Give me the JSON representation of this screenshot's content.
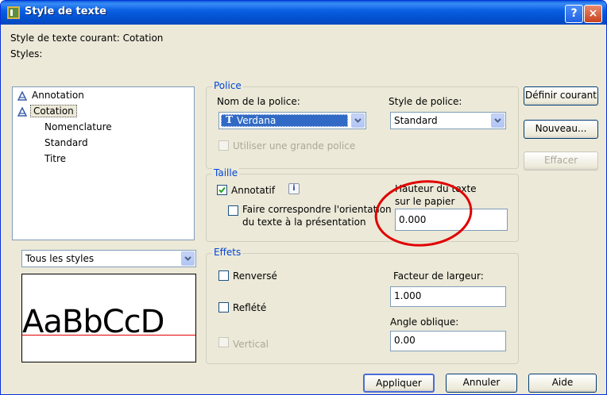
{
  "window": {
    "title": "Style de texte",
    "help_button": "?",
    "close_button": "×"
  },
  "current_style": "Style de texte courant: Cotation",
  "styles": {
    "label": "Styles:",
    "items": [
      {
        "label": "Annotation",
        "annotative": true,
        "selected": false
      },
      {
        "label": "Cotation",
        "annotative": true,
        "selected": true
      },
      {
        "label": "Nomenclature",
        "annotative": false,
        "selected": false
      },
      {
        "label": "Standard",
        "annotative": false,
        "selected": false
      },
      {
        "label": "Titre",
        "annotative": false,
        "selected": false
      }
    ],
    "filter_value": "Tous les styles",
    "preview_text": "AaBbCcD"
  },
  "police": {
    "legend": "Police",
    "font_name_label": "Nom de la police:",
    "font_name_value": "Verdana",
    "font_style_label": "Style de police:",
    "font_style_value": "Standard",
    "bigfont_label": "Utiliser une grande police"
  },
  "taille": {
    "legend": "Taille",
    "annotative_label": "Annotatif",
    "annotative_checked": true,
    "info_icon": "i",
    "match_orientation_line1": "Faire correspondre l'orientation",
    "match_orientation_line2": "du texte à la présentation",
    "paper_height_line1": "Hauteur du texte",
    "paper_height_line2": "sur le papier",
    "paper_height_value": "0.000"
  },
  "effets": {
    "legend": "Effets",
    "upside_down_label": "Renversé",
    "backwards_label": "Reflété",
    "vertical_label": "Vertical",
    "width_factor_label": "Facteur de largeur:",
    "width_factor_value": "1.000",
    "oblique_angle_label": "Angle oblique:",
    "oblique_angle_value": "0.00"
  },
  "buttons": {
    "set_current": "Définir courant",
    "new": "Nouveau...",
    "delete": "Effacer",
    "apply": "Appliquer",
    "cancel": "Annuler",
    "help": "Aide"
  },
  "colors": {
    "title_bar": "#0a60e4",
    "selection": "#0a246a",
    "annotation_circle": "#e00000",
    "legend_text": "#0046d5"
  }
}
